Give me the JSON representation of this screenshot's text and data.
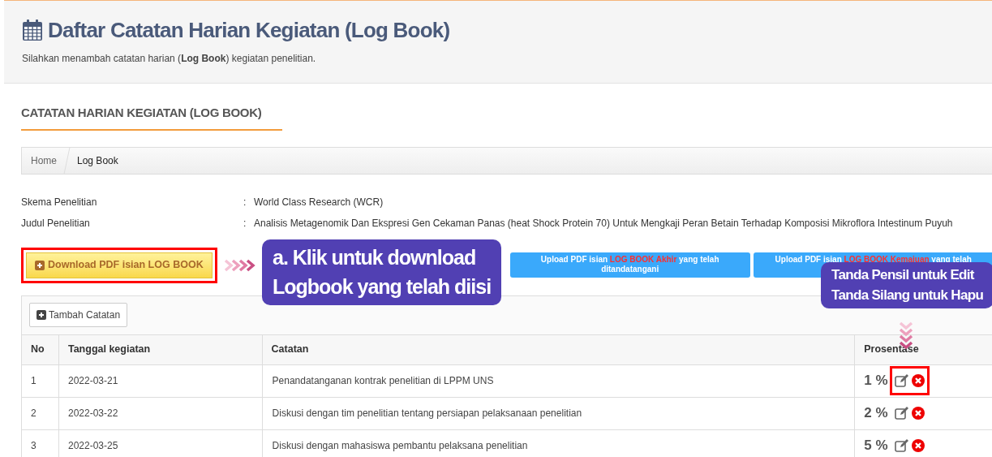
{
  "header": {
    "title": "Daftar Catatan Harian Kegiatan (Log Book)",
    "subtitle": "Silahkan menambah catatan harian (**Log Book**) kegiatan penelitian."
  },
  "section_title": "CATATAN HARIAN KEGIATAN (LOG BOOK)",
  "breadcrumb": [
    {
      "label": "Home",
      "selected": false
    },
    {
      "label": "Log Book",
      "selected": true
    }
  ],
  "info": [
    {
      "label": "Skema Penelitian",
      "separator": ":",
      "value": "World Class Research (WCR)"
    },
    {
      "label": "Judul Penelitian",
      "separator": ":",
      "value": "Analisis Metagenomik Dan Ekspresi Gen Cekaman Panas (heat Shock Protein 70) Untuk Mengkaji Peran Betain Terhadap Komposisi Mikroflora Intestinum Puyuh"
    }
  ],
  "download_button": {
    "label": "Download PDF isian LOG BOOK",
    "highlighted": true
  },
  "upload_buttons": [
    {
      "lines": [
        [
          {
            "text": "Upload PDF isian ",
            "emphasis": false
          },
          {
            "text": "LOG BOOK Akhir",
            "emphasis": true
          },
          {
            "text": " yang telah",
            "emphasis": false
          }
        ],
        [
          {
            "text": "ditandatangani",
            "emphasis": false
          }
        ]
      ]
    },
    {
      "lines": [
        [
          {
            "text": "Upload PDF isian ",
            "emphasis": false
          },
          {
            "text": "LOG BOOK Kemajuan",
            "emphasis": true
          },
          {
            "text": " yang telah",
            "emphasis": false
          }
        ]
      ]
    }
  ],
  "callouts": [
    {
      "lines": [
        "a. Klik untuk download",
        "Logbook yang telah diisi"
      ]
    },
    {
      "lines": [
        "Tanda Pensil untuk Edit",
        "Tanda Silang untuk Hapu"
      ]
    }
  ],
  "add_button": {
    "label": "Tambah Catatan"
  },
  "table": {
    "columns": [
      "No",
      "Tanggal kegiatan",
      "Catatan",
      "Prosentase"
    ],
    "rows": [
      {
        "no": "1",
        "date": "2022-03-21",
        "note": "Penandatanganan kontrak penelitian di LPPM UNS",
        "percent": "1 %",
        "highlighted": true
      },
      {
        "no": "2",
        "date": "2022-03-22",
        "note": "Diskusi dengan tim penelitian tentang persiapan pelaksanaan penelitian",
        "percent": "2 %",
        "highlighted": false
      },
      {
        "no": "3",
        "date": "2022-03-25",
        "note": "Diskusi dengan mahasiswa pembantu pelaksana penelitian",
        "percent": "5 %",
        "highlighted": false
      }
    ]
  }
}
